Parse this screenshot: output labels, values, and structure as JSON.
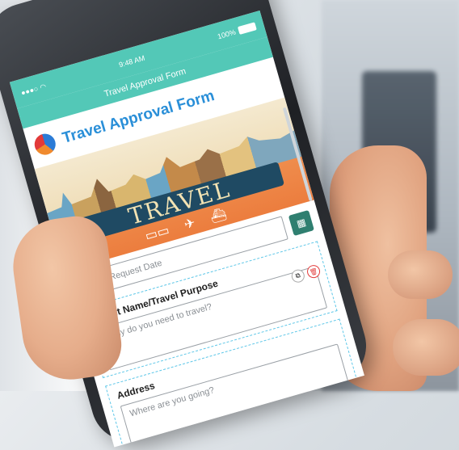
{
  "status_bar": {
    "time": "9:48 AM",
    "battery": "100%"
  },
  "nav": {
    "title": "Travel Approval Form"
  },
  "form_header": {
    "title": "Travel Approval Form"
  },
  "banner": {
    "text": "TRAVEL"
  },
  "fields": {
    "request_date": {
      "placeholder": "Travel Request Date"
    },
    "event_name": {
      "label": "Event Name/Travel Purpose",
      "placeholder": "Why do you need to travel?"
    },
    "address": {
      "label": "Address",
      "placeholder": "Where are you going?"
    }
  },
  "colors": {
    "accent": "#53c8b7",
    "title_blue": "#2a8fd8",
    "calendar_button": "#2f7f70",
    "banner_orange": "#ec7d3e"
  },
  "icons": [
    "wifi-icon",
    "battery-icon",
    "logo-globe-icon",
    "calendar-icon",
    "copy-icon",
    "delete-icon",
    "train-icon",
    "plane-icon",
    "ship-icon"
  ]
}
